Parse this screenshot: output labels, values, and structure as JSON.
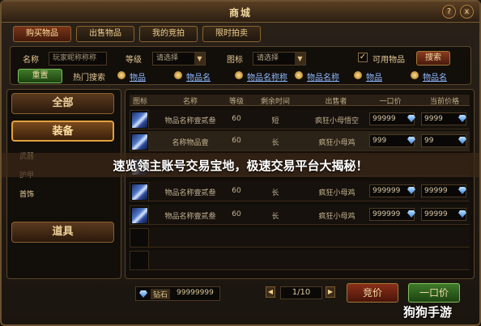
{
  "window": {
    "title": "商城",
    "close_label": "x",
    "min_label": "?"
  },
  "tabs": [
    {
      "label": "购买物品"
    },
    {
      "label": "出售物品"
    },
    {
      "label": "我的竞拍"
    },
    {
      "label": "限时拍卖"
    }
  ],
  "search": {
    "name_label": "名称",
    "name_value": "玩家昵称称称",
    "level_label": "等级",
    "level_value": "请选择",
    "icon_label": "图标",
    "icon_value": "请选择",
    "usable_label": "可用物品",
    "usable_checked": true,
    "search_button": "搜索",
    "reset_button": "重置",
    "hot_label": "热门搜索",
    "hot_items": [
      "物品",
      "物品名",
      "物品名称称",
      "物品名称",
      "物品",
      "物品名"
    ]
  },
  "categories": [
    {
      "label": "全部"
    },
    {
      "label": "装备"
    },
    {
      "label": "道具"
    }
  ],
  "subcategories": [
    "武器",
    "护甲",
    "首饰"
  ],
  "table": {
    "headers": [
      "图标",
      "名称",
      "等级",
      "剩余时间",
      "出售者",
      "一口价",
      "当前价格"
    ],
    "rows": [
      {
        "name": "物品名称壹贰叁",
        "level": "60",
        "time": "短",
        "seller": "疯狂小母悟空",
        "buyout": "99999",
        "current": "9999"
      },
      {
        "name": "名称物品壹",
        "level": "60",
        "time": "长",
        "seller": "疯狂小母鸡",
        "buyout": "999",
        "current": "99"
      },
      {
        "name": "",
        "level": "",
        "time": "",
        "seller": "",
        "buyout": "",
        "current": ""
      },
      {
        "name": "物品名称壹贰叁",
        "level": "60",
        "time": "长",
        "seller": "疯狂小母鸡",
        "buyout": "999999",
        "current": "99999"
      },
      {
        "name": "物品名称壹贰叁",
        "level": "60",
        "time": "长",
        "seller": "疯狂小母鸡",
        "buyout": "999999",
        "current": "99999"
      }
    ]
  },
  "footer": {
    "currency_label": "钻石",
    "currency_value": "99999999",
    "page": "1/10",
    "bid_button": "竞价",
    "buyout_button": "一口价"
  },
  "banner": {
    "text": "速览领主账号交易宝地，极速交易平台大揭秘！"
  },
  "watermark": {
    "text": "狗狗手游"
  }
}
